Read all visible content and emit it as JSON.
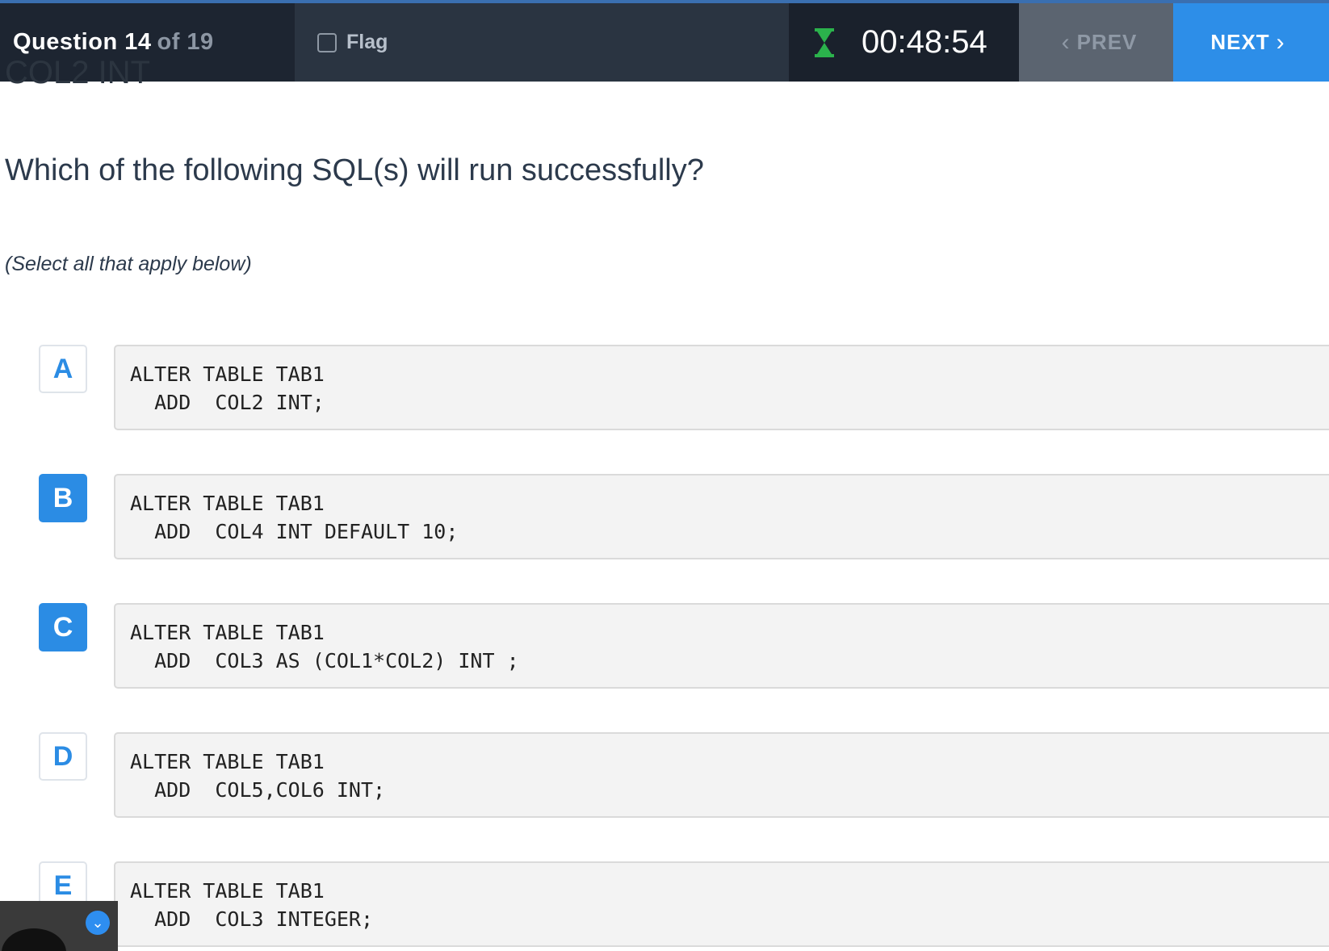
{
  "header": {
    "question_label": "Question 14",
    "question_total": "of 19",
    "flag_label": "Flag",
    "timer": "00:48:54",
    "prev_label": "PREV",
    "next_label": "NEXT"
  },
  "question": {
    "cut_off_text": "COL2 INT",
    "text": "Which of the following SQL(s) will run successfully?",
    "instruction": "(Select all that apply below)"
  },
  "options": [
    {
      "letter": "A",
      "line1": "ALTER TABLE TAB1",
      "line2": "  ADD  COL2 INT;",
      "selected": false
    },
    {
      "letter": "B",
      "line1": "ALTER TABLE TAB1",
      "line2": "  ADD  COL4 INT DEFAULT 10;",
      "selected": true
    },
    {
      "letter": "C",
      "line1": "ALTER TABLE TAB1",
      "line2": "  ADD  COL3 AS (COL1*COL2) INT ;",
      "selected": true
    },
    {
      "letter": "D",
      "line1": "ALTER TABLE TAB1",
      "line2": "  ADD  COL5,COL6 INT;",
      "selected": false
    },
    {
      "letter": "E",
      "line1": "ALTER TABLE TAB1",
      "line2": "  ADD  COL3 INTEGER;",
      "selected": false
    }
  ],
  "icons": {
    "hourglass": "hourglass-icon",
    "prev": "chevron-left-icon",
    "next": "chevron-right-icon",
    "webcam_badge": "chevron-down-icon"
  },
  "colors": {
    "accent": "#2b8ce4",
    "header_bg": "#222b38",
    "timer_icon": "#2bb24c"
  }
}
